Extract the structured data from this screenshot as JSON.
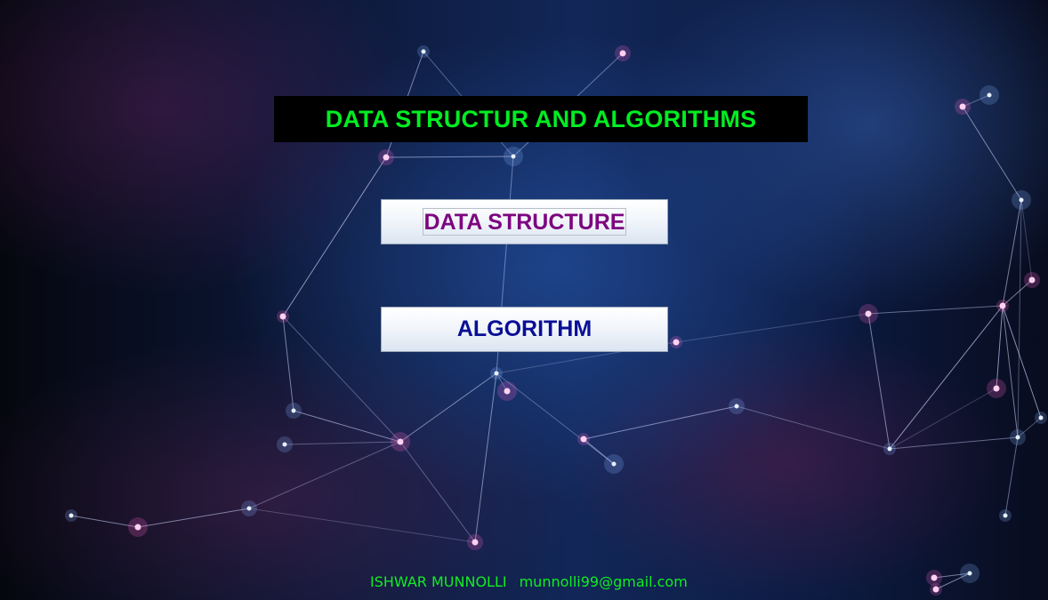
{
  "title": "DATA STRUCTUR AND ALGORITHMS",
  "buttons": {
    "data_structure": "DATA STRUCTURE",
    "algorithm": "ALGORITHM"
  },
  "footer": {
    "author": "ISHWAR MUNNOLLI",
    "email": "munnolli99@gmail.com"
  },
  "colors": {
    "title_text": "#00ee22",
    "title_background": "#000000",
    "data_structure_text": "#7d0680",
    "algorithm_text": "#0a0f96",
    "footer_text": "#11ee22"
  }
}
